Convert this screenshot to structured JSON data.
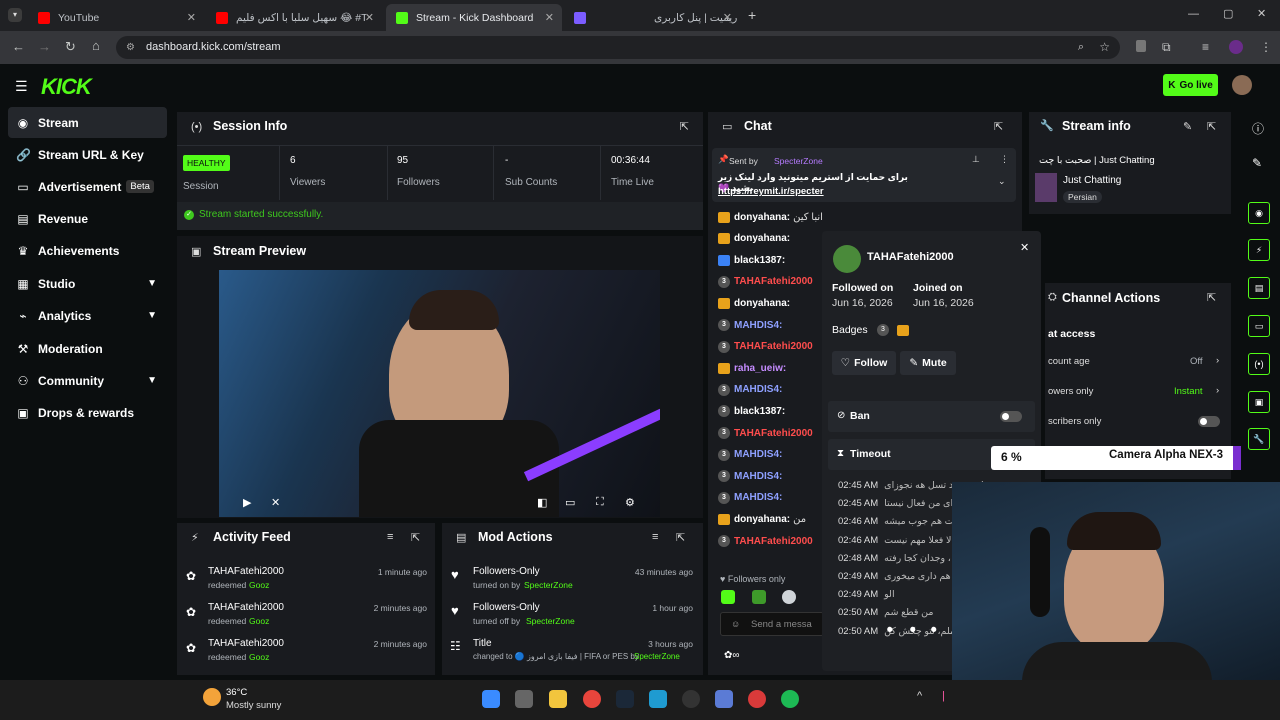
{
  "browser": {
    "tabs": [
      {
        "title": "YouTube",
        "color": "#ff0000"
      },
      {
        "title": "سهیل سلبا با اکس فلیم 😂 #Tube",
        "color": "#ff0000"
      },
      {
        "title": "Stream - Kick Dashboard",
        "color": "#53fc18"
      },
      {
        "title": "ریمیت | پنل کاربری",
        "color": "#7b5cff"
      }
    ],
    "url": "dashboard.kick.com/stream"
  },
  "header": {
    "logo": "KICK",
    "go_live": "Go live"
  },
  "sidebar": {
    "items": [
      {
        "label": "Stream",
        "icon": "broadcast-icon"
      },
      {
        "label": "Stream URL & Key",
        "icon": "link-icon"
      },
      {
        "label": "Advertisement",
        "icon": "tv-icon",
        "badge": "Beta"
      },
      {
        "label": "Revenue",
        "icon": "revenue-icon"
      },
      {
        "label": "Achievements",
        "icon": "trophy-icon"
      },
      {
        "label": "Studio",
        "icon": "studio-icon"
      },
      {
        "label": "Analytics",
        "icon": "analytics-icon"
      },
      {
        "label": "Moderation",
        "icon": "hammer-icon"
      },
      {
        "label": "Community",
        "icon": "people-icon"
      },
      {
        "label": "Drops & rewards",
        "icon": "gift-icon"
      }
    ]
  },
  "session": {
    "title": "Session Info",
    "health": "HEALTHY",
    "health_label": "Session",
    "stats": [
      {
        "value": "6",
        "label": "Viewers"
      },
      {
        "value": "95",
        "label": "Followers"
      },
      {
        "value": "-",
        "label": "Sub Counts"
      },
      {
        "value": "00:36:44",
        "label": "Time Live"
      }
    ],
    "status": "Stream started successfully."
  },
  "preview": {
    "title": "Stream Preview"
  },
  "activity": {
    "title": "Activity Feed",
    "items": [
      {
        "user": "TAHAFatehi2000",
        "action": "redeemed",
        "item": "Gooz",
        "time": "1 minute ago"
      },
      {
        "user": "TAHAFatehi2000",
        "action": "redeemed",
        "item": "Gooz",
        "time": "2 minutes ago"
      },
      {
        "user": "TAHAFatehi2000",
        "action": "redeemed",
        "item": "Gooz",
        "time": "2 minutes ago"
      }
    ]
  },
  "mod": {
    "title": "Mod Actions",
    "items": [
      {
        "title": "Followers-Only",
        "desc": "turned on by",
        "by": "SpecterZone",
        "time": "43 minutes ago"
      },
      {
        "title": "Followers-Only",
        "desc": "turned off by",
        "by": "SpecterZone",
        "time": "1 hour ago"
      },
      {
        "title": "Title",
        "desc": "changed to 🔵 فیفا بازی امروز | FIFA or PES by",
        "by": "SpecterZone",
        "time": "3 hours ago"
      }
    ]
  },
  "chat": {
    "title": "Chat",
    "pinned_by_label": "Sent by",
    "pinned_by": "SpecterZone",
    "pinned_text": "برای حمایت از استریم میتونید وارد لینک زیر بشید 💜",
    "pinned_link": "https://reymit.ir/specter",
    "messages": [
      {
        "user": "donyahana:",
        "text": "انبا کین",
        "color": "#ffffff",
        "badge": "crown"
      },
      {
        "user": "donyahana:",
        "text": "",
        "color": "#ffffff",
        "badge": "crown"
      },
      {
        "user": "black1387:",
        "text": "",
        "color": "#ffffff",
        "badge": "blue"
      },
      {
        "user": "TAHAFatehi2000",
        "text": "",
        "color": "#ff4d4d",
        "badge": "num"
      },
      {
        "user": "donyahana:",
        "text": "",
        "color": "#ffffff",
        "badge": "crown"
      },
      {
        "user": "MAHDIS4:",
        "text": "",
        "color": "#8ea0ff",
        "badge": "num"
      },
      {
        "user": "TAHAFatehi2000",
        "text": "",
        "color": "#ff4d4d",
        "badge": "num"
      },
      {
        "user": "raha_ueiw:",
        "text": "",
        "color": "#c58cff",
        "badge": "crown"
      },
      {
        "user": "MAHDIS4:",
        "text": "",
        "color": "#8ea0ff",
        "badge": "num"
      },
      {
        "user": "black1387:",
        "text": "",
        "color": "#ffffff",
        "badge": "num"
      },
      {
        "user": "TAHAFatehi2000",
        "text": "",
        "color": "#ff4d4d",
        "badge": "num"
      },
      {
        "user": "MAHDIS4:",
        "text": "",
        "color": "#8ea0ff",
        "badge": "num"
      },
      {
        "user": "MAHDIS4:",
        "text": "",
        "color": "#8ea0ff",
        "badge": "num"
      },
      {
        "user": "MAHDIS4:",
        "text": "",
        "color": "#8ea0ff",
        "badge": "num"
      },
      {
        "user": "donyahana:",
        "text": "من",
        "color": "#ffffff",
        "badge": "crown"
      },
      {
        "user": "TAHAFatehi2000",
        "text": "",
        "color": "#ff4d4d",
        "badge": "num"
      }
    ],
    "followers_only": "Followers only",
    "placeholder": "Send a messa"
  },
  "user_popup": {
    "username": "TAHAFatehi2000",
    "followed_label": "Followed on",
    "followed_date": "Jun 16, 2026",
    "joined_label": "Joined on",
    "joined_date": "Jun 16, 2026",
    "badges_label": "Badges",
    "follow": "Follow",
    "mute": "Mute",
    "ban": "Ban",
    "timeout": "Timeout",
    "log_times": [
      "02:45 AM",
      "02:45 AM",
      "02:46 AM",
      "02:46 AM",
      "02:48 AM",
      "02:49 AM",
      "02:49 AM",
      "02:50 AM",
      "02:50 AM"
    ],
    "log_texts": [
      "سحنت مهلونیه چند تسل هه نجوزای",
      "خیلی برای من فعال نیستا 😂",
      "کس آنمیزیت هم جوب میشه",
      "خالا فعلا مهم نیست",
      "امش ، وجدان کجا رفته",
      "منا هم داری میخوری",
      "الو",
      "من قطع شم",
      "ت ملم، نتو چکش کن"
    ]
  },
  "stream_info": {
    "title": "Stream info",
    "stream_title": "صحبت با چت | Just Chatting",
    "category": "Just Chatting",
    "tag": "Persian"
  },
  "channel_actions": {
    "title": "Channel Actions",
    "section": "at access",
    "rows": [
      {
        "label": "count age",
        "value": "Off"
      },
      {
        "label": "owers only",
        "value": "Instant"
      },
      {
        "label": "scribers only",
        "value": ""
      }
    ]
  },
  "overlay": {
    "percent": "6 %",
    "camera": "Camera Alpha NEX-3"
  },
  "taskbar": {
    "temp": "36°C",
    "weather": "Mostly sunny"
  }
}
